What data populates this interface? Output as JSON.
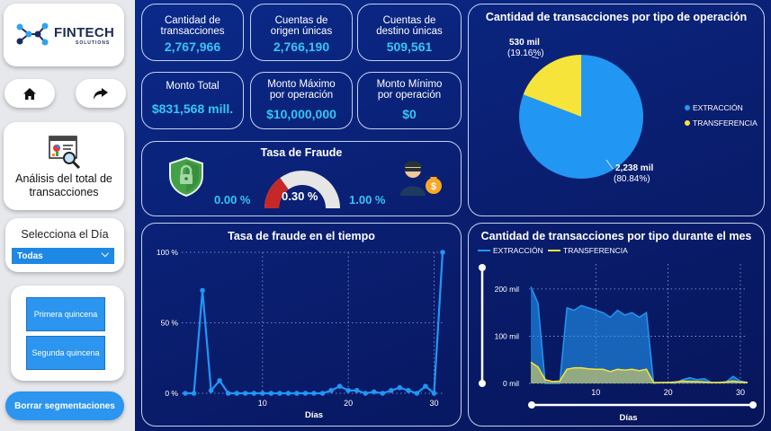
{
  "brand": {
    "name": "FINTECH",
    "sub": "SOLUTIONS"
  },
  "nav": {
    "home_icon": "home-icon",
    "forward_icon": "forward-arrow-icon"
  },
  "analysis": {
    "label": "Análisis del total de transacciones",
    "icon": "report-magnifier-icon"
  },
  "day_filter": {
    "title": "Selecciona el Día",
    "selected": "Todas",
    "chevron": "⌵"
  },
  "buttons": {
    "first_half": "Primera quincena",
    "second_half": "Segunda quincena",
    "clear": "Borrar segmentaciones"
  },
  "kpis": {
    "transactions": {
      "title_1": "Cantidad de",
      "title_2": "transacciones",
      "value": "2,767,966"
    },
    "origin_accounts": {
      "title_1": "Cuentas de",
      "title_2": "origen únicas",
      "value": "2,766,190"
    },
    "dest_accounts": {
      "title_1": "Cuentas de",
      "title_2": "destino únicas",
      "value": "509,561"
    },
    "total_amount": {
      "title_1": "Monto Total",
      "value": "$831,568 mill."
    },
    "max_amount": {
      "title_1": "Monto Máximo",
      "title_2": "por operación",
      "value": "$10,000,000"
    },
    "min_amount": {
      "title_1": "Monto Mínimo",
      "title_2": "por operación",
      "value": "$0"
    }
  },
  "fraud_rate": {
    "title": "Tasa de Fraude",
    "min": "0.00 %",
    "value": "0.30 %",
    "max": "1.00 %",
    "fraction": 0.3,
    "icons": [
      "shield-lock-icon",
      "thief-icon"
    ]
  },
  "colors": {
    "accent": "#35c6f4",
    "extraccion": "#2196f3",
    "transferencia": "#f6e43a",
    "gauge_fill": "#c62828",
    "gauge_track": "#e6e6e6"
  },
  "chart_data": [
    {
      "type": "pie",
      "title": "Cantidad de transacciones por tipo de operación",
      "categories": [
        "EXTRACCIÓN",
        "TRANSFERENCIA"
      ],
      "values": [
        2238,
        530
      ],
      "value_labels": [
        "2,238 mil",
        "530 mil"
      ],
      "percent_labels": [
        "(80.84%)",
        "(19.16%)"
      ],
      "legend": "right"
    },
    {
      "type": "line",
      "title": "Tasa de fraude en el tiempo",
      "xlabel": "Días",
      "x_ticks": [
        10,
        20,
        30
      ],
      "y_ticks": [
        "0 %",
        "50 %",
        "100 %"
      ],
      "ylim": [
        0,
        100
      ],
      "xlim": [
        1,
        31
      ],
      "x": [
        1,
        2,
        3,
        4,
        5,
        6,
        7,
        8,
        9,
        10,
        11,
        12,
        13,
        14,
        15,
        16,
        17,
        18,
        19,
        20,
        21,
        22,
        23,
        24,
        25,
        26,
        27,
        28,
        29,
        30,
        31
      ],
      "values": [
        0,
        0,
        73,
        2,
        9,
        0,
        0,
        0,
        0,
        0,
        0,
        0,
        0,
        0,
        0,
        0,
        0,
        2,
        5,
        2,
        2,
        0,
        1,
        0,
        2,
        4,
        2,
        0,
        5,
        0,
        100
      ],
      "grid": true
    },
    {
      "type": "area",
      "title": "Cantidad de transacciones por tipo durante el mes",
      "xlabel": "Días",
      "x_ticks": [
        10,
        20,
        30
      ],
      "y_ticks": [
        "0 mil",
        "100 mil",
        "200 mil"
      ],
      "ylim": [
        0,
        215
      ],
      "xlim": [
        1,
        31
      ],
      "legend": "top-left",
      "x": [
        1,
        2,
        3,
        4,
        5,
        6,
        7,
        8,
        9,
        10,
        11,
        12,
        13,
        14,
        15,
        16,
        17,
        18,
        19,
        20,
        21,
        22,
        23,
        24,
        25,
        26,
        27,
        28,
        29,
        30,
        31
      ],
      "series": [
        {
          "name": "EXTRACCIÓN",
          "values": [
            205,
            170,
            0,
            0,
            0,
            160,
            155,
            165,
            160,
            155,
            150,
            140,
            155,
            145,
            150,
            140,
            150,
            0,
            2,
            2,
            0,
            8,
            12,
            8,
            10,
            2,
            2,
            3,
            15,
            5,
            2
          ]
        },
        {
          "name": "TRANSFERENCIA",
          "values": [
            45,
            35,
            8,
            4,
            5,
            30,
            33,
            33,
            31,
            30,
            30,
            25,
            30,
            28,
            30,
            27,
            30,
            2,
            2,
            2,
            3,
            5,
            4,
            4,
            3,
            2,
            2,
            3,
            5,
            3,
            2
          ]
        }
      ]
    }
  ]
}
